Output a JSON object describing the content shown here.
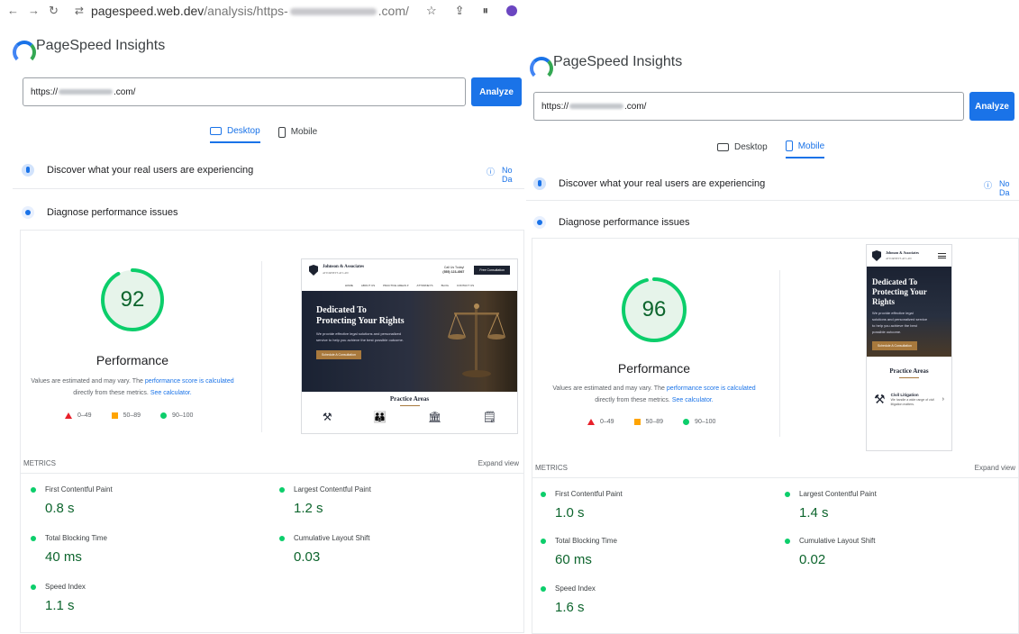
{
  "browser": {
    "url_host": "pagespeed.web.dev",
    "url_path": "/analysis/https-",
    "url_tail": ".com/"
  },
  "left": {
    "brand": "PageSpeed Insights",
    "url_prefix": "https://",
    "url_suffix": ".com/",
    "analyze_label": "Analyze",
    "tabs": [
      {
        "label": "Desktop",
        "active": true
      },
      {
        "label": "Mobile",
        "active": false
      }
    ],
    "discover_label": "Discover what your real users are experiencing",
    "no_data_label": "No Da",
    "diagnose_label": "Diagnose performance issues",
    "score": 92,
    "perf_title": "Performance",
    "note_1": "Values are estimated and may vary. The ",
    "note_link_1": "performance score is calculated",
    "note_2": "directly from these metrics. ",
    "note_link_2": "See calculator.",
    "legend": [
      "0–49",
      "50–89",
      "90–100"
    ],
    "metrics_label": "METRICS",
    "expand_label": "Expand view",
    "metrics": [
      {
        "name": "First Contentful Paint",
        "value": "0.8 s"
      },
      {
        "name": "Largest Contentful Paint",
        "value": "1.2 s"
      },
      {
        "name": "Total Blocking Time",
        "value": "40 ms"
      },
      {
        "name": "Cumulative Layout Shift",
        "value": "0.03"
      },
      {
        "name": "Speed Index",
        "value": "1.1 s"
      }
    ]
  },
  "right": {
    "brand": "PageSpeed Insights",
    "url_prefix": "https://",
    "url_suffix": ".com/",
    "analyze_label": "Analyze",
    "tabs": [
      {
        "label": "Desktop",
        "active": false
      },
      {
        "label": "Mobile",
        "active": true
      }
    ],
    "discover_label": "Discover what your real users are experiencing",
    "no_data_label": "No Da",
    "diagnose_label": "Diagnose performance issues",
    "score": 96,
    "perf_title": "Performance",
    "note_1": "Values are estimated and may vary. The ",
    "note_link_1": "performance score is calculated",
    "note_2": "directly from these metrics. ",
    "note_link_2": "See calculator.",
    "legend": [
      "0–49",
      "50–89",
      "90–100"
    ],
    "metrics_label": "METRICS",
    "expand_label": "Expand view",
    "metrics": [
      {
        "name": "First Contentful Paint",
        "value": "1.0 s"
      },
      {
        "name": "Largest Contentful Paint",
        "value": "1.4 s"
      },
      {
        "name": "Total Blocking Time",
        "value": "60 ms"
      },
      {
        "name": "Cumulative Layout Shift",
        "value": "0.02"
      },
      {
        "name": "Speed Index",
        "value": "1.6 s"
      }
    ]
  },
  "thumb_desktop": {
    "firm": "Johnson & Associates",
    "firm_sub": "ATTORNEYS AT LAW",
    "call_1": "Call Us Today!",
    "call_2": "(555) 123-4567",
    "consult": "Free Consultation",
    "menu": [
      "HOME",
      "ABOUT US",
      "PRACTICE AREAS ▾",
      "ATTORNEYS",
      "BLOG",
      "CONTACT US"
    ],
    "hero_title_1": "Dedicated To",
    "hero_title_2": "Protecting Your Rights",
    "hero_text": "We provide effective legal solutions and personalized service to help you achieve the best possible outcome.",
    "hero_btn": "Schedule A Consultation",
    "practice": "Practice Areas"
  },
  "thumb_mobile": {
    "firm": "Johnson & Associates",
    "firm_sub": "ATTORNEYS AT LAW",
    "hero_title_1": "Dedicated To",
    "hero_title_2": "Protecting Your Rights",
    "hero_text": "We provide effective legal solutions and personalized service to help you achieve the best possible outcome.",
    "hero_btn": "Schedule A Consultation",
    "practice": "Practice Areas",
    "civ_title": "Civil Litigation",
    "civ_text": "We handle a wide range of civil litigation matters."
  },
  "colors": {
    "good": "#0cce6b",
    "average": "#ffa400",
    "poor": "#e8202a",
    "accent": "#1a73e8"
  }
}
